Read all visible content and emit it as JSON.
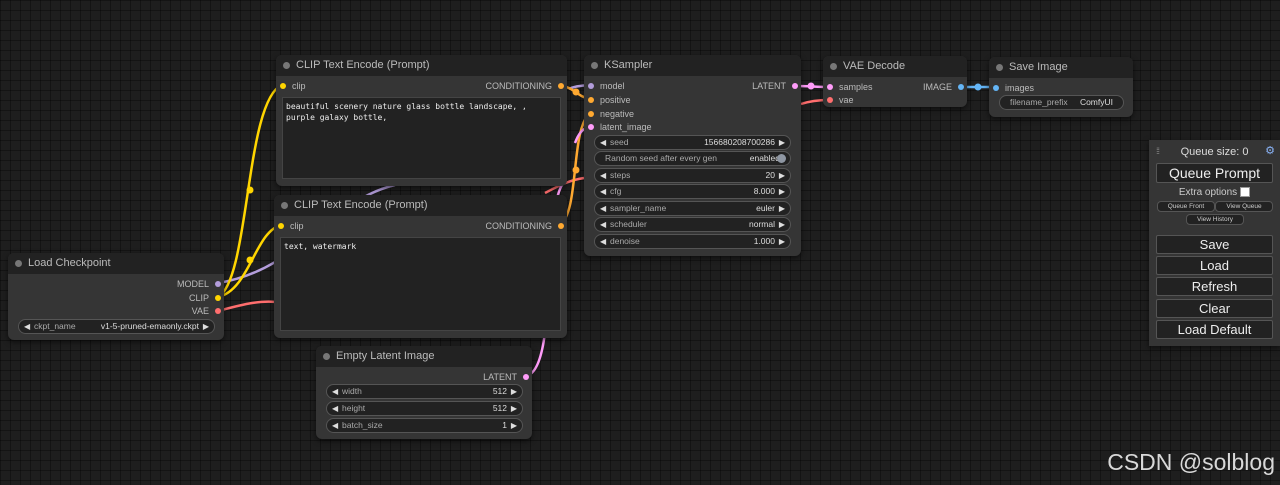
{
  "colors": {
    "clip": "#ffd500",
    "model": "#b39ddb",
    "vae": "#ff6e6e",
    "conditioning": "#ffa931",
    "latent": "#ff9cf9",
    "image": "#64b5f6"
  },
  "nodes": {
    "clip_pos": {
      "title": "CLIP Text Encode (Prompt)",
      "in_clip": "clip",
      "out_cond": "CONDITIONING",
      "text": "beautiful scenery nature glass bottle landscape, , purple galaxy bottle,"
    },
    "clip_neg": {
      "title": "CLIP Text Encode (Prompt)",
      "in_clip": "clip",
      "out_cond": "CONDITIONING",
      "text": "text, watermark"
    },
    "checkpoint": {
      "title": "Load Checkpoint",
      "out_model": "MODEL",
      "out_clip": "CLIP",
      "out_vae": "VAE",
      "ckpt_label": "ckpt_name",
      "ckpt_value": "v1-5-pruned-emaonly.ckpt"
    },
    "latent": {
      "title": "Empty Latent Image",
      "out_latent": "LATENT",
      "width_label": "width",
      "width_value": "512",
      "height_label": "height",
      "height_value": "512",
      "batch_label": "batch_size",
      "batch_value": "1"
    },
    "ksampler": {
      "title": "KSampler",
      "in_model": "model",
      "in_positive": "positive",
      "in_negative": "negative",
      "in_latent": "latent_image",
      "out_latent": "LATENT",
      "seed_label": "seed",
      "seed_value": "156680208700286",
      "random_label": "Random seed after every gen",
      "random_value": "enabled",
      "steps_label": "steps",
      "steps_value": "20",
      "cfg_label": "cfg",
      "cfg_value": "8.000",
      "sampler_label": "sampler_name",
      "sampler_value": "euler",
      "scheduler_label": "scheduler",
      "scheduler_value": "normal",
      "denoise_label": "denoise",
      "denoise_value": "1.000"
    },
    "vae_decode": {
      "title": "VAE Decode",
      "in_samples": "samples",
      "in_vae": "vae",
      "out_image": "IMAGE"
    },
    "save_image": {
      "title": "Save Image",
      "in_images": "images",
      "prefix_label": "filename_prefix",
      "prefix_value": "ComfyUI"
    }
  },
  "menu": {
    "queue_size": "Queue size: 0",
    "queue_prompt": "Queue Prompt",
    "extra_options": "Extra options",
    "queue_front": "Queue Front",
    "view_queue": "View Queue",
    "view_history": "View History",
    "save": "Save",
    "load": "Load",
    "refresh": "Refresh",
    "clear": "Clear",
    "load_default": "Load Default"
  },
  "watermark": "CSDN @solblog"
}
